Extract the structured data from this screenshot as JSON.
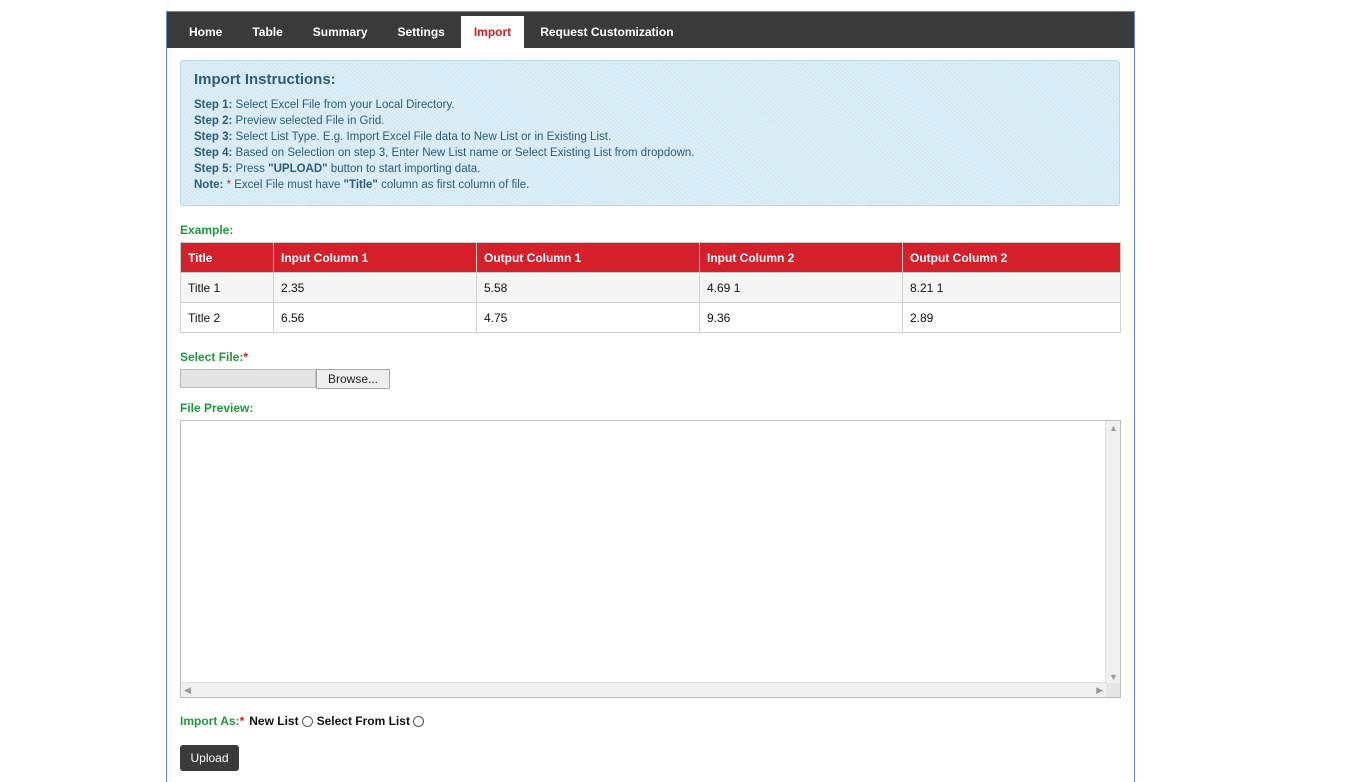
{
  "nav": {
    "tabs": [
      {
        "label": "Home"
      },
      {
        "label": "Table"
      },
      {
        "label": "Summary"
      },
      {
        "label": "Settings"
      },
      {
        "label": "Import",
        "active": true
      },
      {
        "label": "Request Customization"
      }
    ]
  },
  "instructions": {
    "title": "Import Instructions:",
    "steps": [
      {
        "label": "Step 1:",
        "text": " Select Excel File from your Local Directory."
      },
      {
        "label": "Step 2:",
        "text": " Preview selected File in Grid."
      },
      {
        "label": "Step 3:",
        "text": " Select List Type. E.g. Import Excel File data to New List or in Existing List."
      },
      {
        "label": "Step 4:",
        "text": " Based on Selection on step 3, Enter New List name or Select Existing List from dropdown."
      }
    ],
    "step5": {
      "label": "Step 5:",
      "pre": " Press ",
      "bold": "\"UPLOAD\"",
      "post": " button to start importing data."
    },
    "note": {
      "label": "Note:",
      "star": " *",
      "pre": " Excel File must have ",
      "bold": "\"Title\"",
      "post": " column as first column of file."
    }
  },
  "example": {
    "label": "Example:",
    "headers": [
      "Title",
      "Input Column 1",
      "Output Column 1",
      "Input Column 2",
      "Output Column 2"
    ],
    "rows": [
      [
        "Title 1",
        "2.35",
        "5.58",
        "4.69 1",
        "8.21 1"
      ],
      [
        "Title 2",
        "6.56",
        "4.75",
        "9.36",
        "2.89"
      ]
    ]
  },
  "select_file": {
    "label": "Select File:",
    "required_mark": "*",
    "browse_label": "Browse..."
  },
  "file_preview": {
    "label": "File Preview:"
  },
  "import_as": {
    "label": "Import As:",
    "required_mark": "*",
    "options": [
      "New List",
      "Select From List"
    ]
  },
  "upload": {
    "label": "Upload"
  },
  "colors": {
    "nav_bg": "#3a3a3a",
    "active_tab_text": "#cc2222",
    "header_red": "#d4202a",
    "label_green": "#1f9a3b",
    "instructions_bg": "#d6ebf5"
  }
}
